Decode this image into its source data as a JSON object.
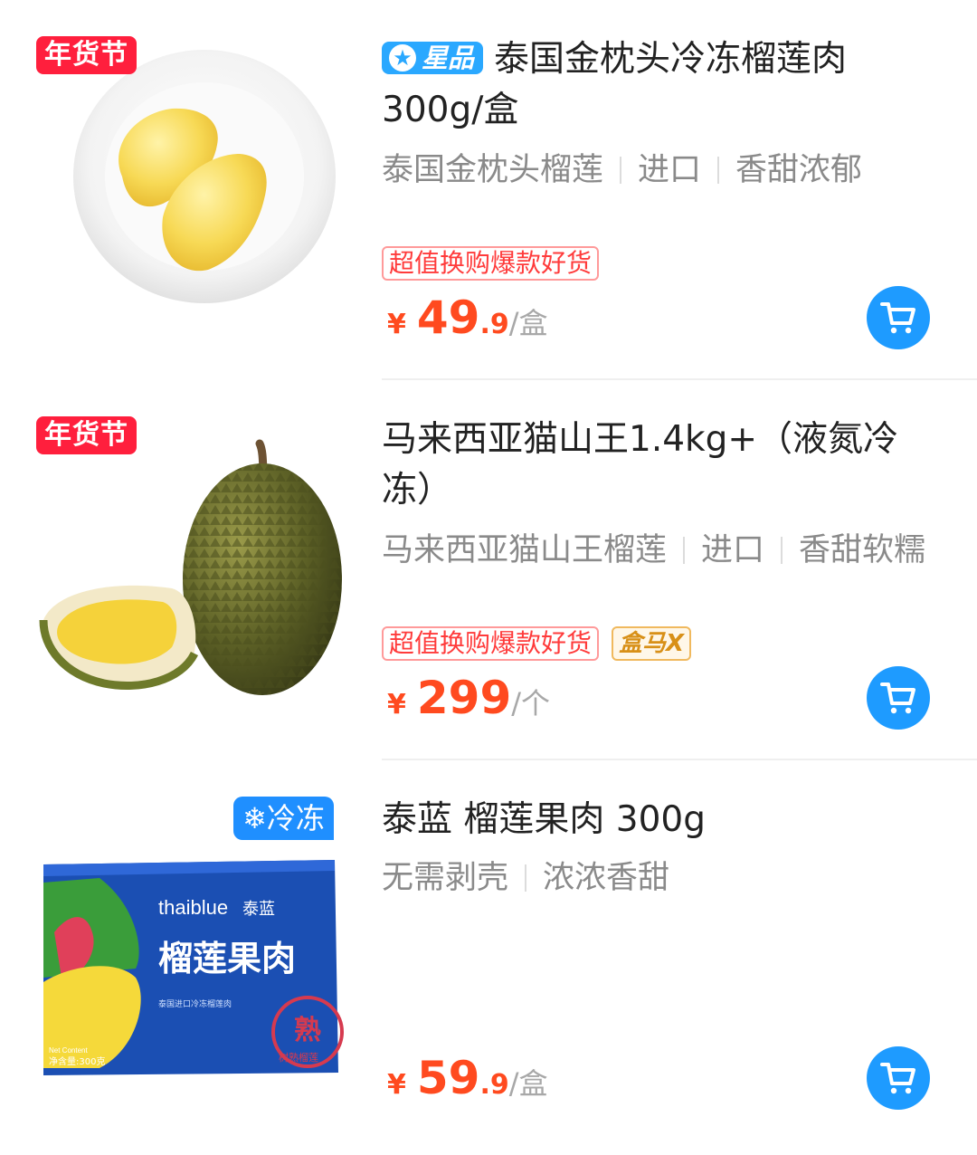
{
  "products": [
    {
      "festival_badge": "年货节",
      "star_badge": "星品",
      "title": "泰国金枕头冷冻榴莲肉300g/盒",
      "tags": [
        "泰国金枕头榴莲",
        "进口",
        "香甜浓郁"
      ],
      "promo": "超值换购爆款好货",
      "price_symbol": "¥",
      "price_int": "49",
      "price_dec": ".9",
      "price_unit": "/盒",
      "image_icon": "frozen-durian-pulp-plate-image",
      "cart_icon": "cart-icon"
    },
    {
      "festival_badge": "年货节",
      "title": "马来西亚猫山王1.4kg+（液氮冷冻）",
      "tags": [
        "马来西亚猫山王榴莲",
        "进口",
        "香甜软糯"
      ],
      "promo": "超值换购爆款好货",
      "brand_tag": "盒马X",
      "price_symbol": "¥",
      "price_int": "299",
      "price_unit": "/个",
      "image_icon": "whole-durian-image",
      "cart_icon": "cart-icon"
    },
    {
      "cold_badge_icon": "snowflake-icon",
      "cold_badge": "冷冻",
      "title": "泰蓝 榴莲果肉 300g",
      "tags": [
        "无需剥壳",
        "浓浓香甜"
      ],
      "price_symbol": "¥",
      "price_int": "59",
      "price_dec": ".9",
      "price_unit": "/盒",
      "image_icon": "thaiblue-durian-box-image",
      "box": {
        "brand_en": "thaiblue",
        "brand_cn": "泰蓝",
        "product_name": "榴莲果肉",
        "subtitle": "泰国进口冷冻榴莲肉",
        "net_content_en": "Net Content",
        "net_content": "净含量:300克",
        "stamp": "熟",
        "stamp_sub": "树熟榴莲"
      },
      "cart_icon": "cart-icon"
    }
  ],
  "colors": {
    "price": "#ff4a1f",
    "cart_button": "#1e9bff",
    "festival_badge": "#ff1f3d",
    "star_badge": "#2aa8ff"
  }
}
